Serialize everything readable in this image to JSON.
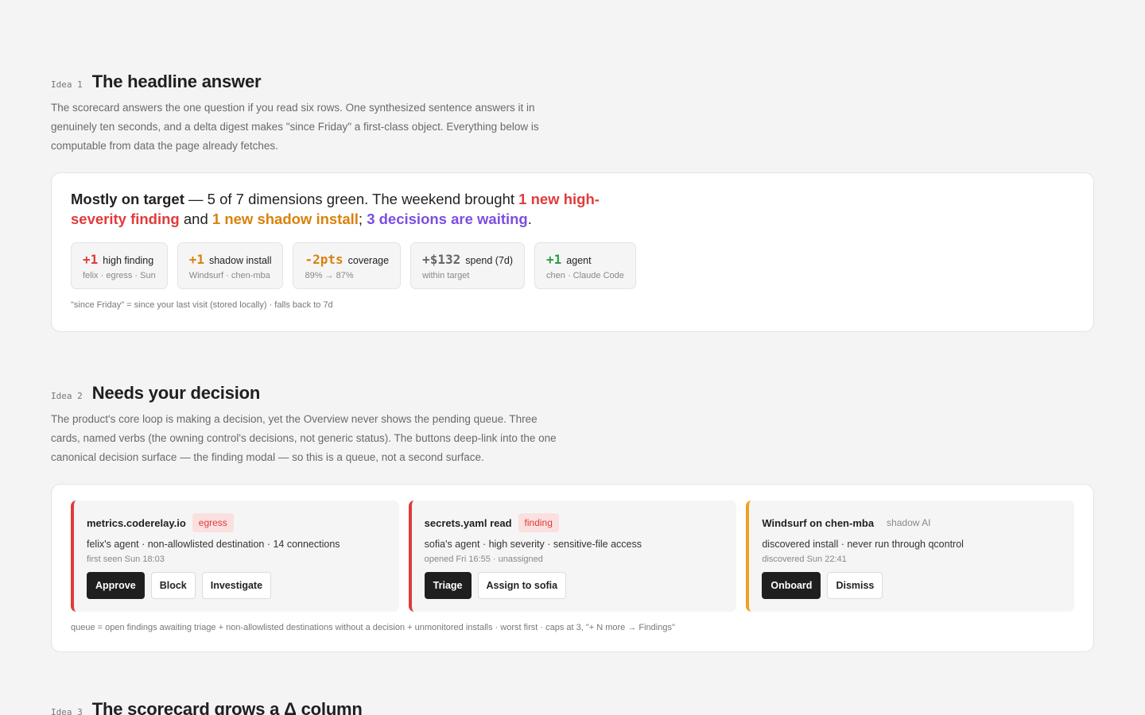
{
  "idea1": {
    "tag": "Idea 1",
    "title": "The headline answer",
    "desc": "The scorecard answers the one question if you read six rows. One synthesized sentence answers it in genuinely ten seconds, and a delta digest makes \"since Friday\" a first-class object. Everything below is computable from data the page already fetches.",
    "headline": {
      "lead": "Mostly on target",
      "part1": " — 5 of 7 dimensions green. The weekend brought ",
      "red": "1 new high-severity finding",
      "and": " and ",
      "orange": "1 new shadow install",
      "semi": "; ",
      "purple": "3 decisions are waiting",
      "end": "."
    },
    "metrics": [
      {
        "value": "+1",
        "label": "high finding",
        "sub": "felix · egress · Sun",
        "color": "#e03b3b"
      },
      {
        "value": "+1",
        "label": "shadow install",
        "sub": "Windsurf · chen-mba",
        "color": "#d9820b"
      },
      {
        "value": "-2pts",
        "label": "coverage",
        "sub": "89% → 87%",
        "color": "#d9820b"
      },
      {
        "value": "+$132",
        "label": "spend (7d)",
        "sub": "within target",
        "color": "#666666"
      },
      {
        "value": "+1",
        "label": "agent",
        "sub": "chen · Claude Code",
        "color": "#2a9d46"
      }
    ],
    "note": "\"since Friday\" = since your last visit (stored locally) · falls back to 7d"
  },
  "idea2": {
    "tag": "Idea 2",
    "title": "Needs your decision",
    "desc": "The product's core loop is making a decision, yet the Overview never shows the pending queue. Three cards, named verbs (the owning control's decisions, not generic status). The buttons deep-link into the one canonical decision surface — the finding modal — so this is a queue, not a second surface.",
    "cards": [
      {
        "title": "metrics.coderelay.io",
        "badge": "egress",
        "line": "felix's agent · non-allowlisted destination · 14 connections",
        "meta": "first seen Sun 18:03",
        "actions": [
          "Approve",
          "Block",
          "Investigate"
        ]
      },
      {
        "title": "secrets.yaml read",
        "badge": "finding",
        "line": "sofia's agent · high severity · sensitive-file access",
        "meta": "opened Fri 16:55 · unassigned",
        "actions": [
          "Triage",
          "Assign to sofia"
        ]
      },
      {
        "title": "Windsurf on chen-mba",
        "badge": "shadow AI",
        "line": "discovered install · never run through qcontrol",
        "meta": "discovered Sun 22:41",
        "actions": [
          "Onboard",
          "Dismiss"
        ]
      }
    ],
    "note": "queue = open findings awaiting triage + non-allowlisted destinations without a decision + unmonitored installs · worst first · caps at 3, \"+ N more → Findings\""
  },
  "idea3": {
    "tag": "Idea 3",
    "title": "The scorecard grows a Δ column"
  }
}
